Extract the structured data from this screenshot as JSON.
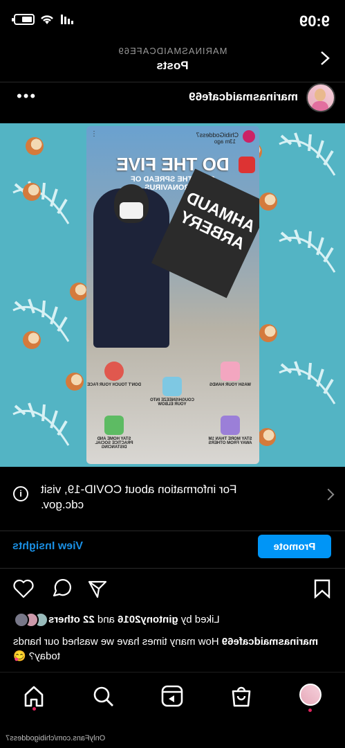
{
  "status_bar": {
    "time": "9:09"
  },
  "header": {
    "account_handle": "MARINASMAIDCAFE69",
    "title": "Posts"
  },
  "post": {
    "username": "marinasmaidcafe69",
    "story": {
      "poster_name": "ChibiGoddess7",
      "poster_time": "13m ago",
      "headline": "DO THE FIVE",
      "subline_1": "STOP THE SPREAD OF",
      "subline_2": "CORONAVIRUS",
      "sign_text_1": "AHMAUD",
      "sign_text_2": "ARBERY",
      "tips": [
        "WASH YOUR HANDS",
        "DON'T TOUCH YOUR FACE",
        "COUGH/SNEEZE INTO YOUR ELBOW",
        "STAY MORE THAN 1M AWAY FROM OTHERS",
        "STAY HOME AND PRACTICE SOCIAL DISTANCING"
      ]
    },
    "info_banner": "For information about COVID-19, visit cdc.gov.",
    "promote_label": "Promote",
    "insights_label": "View Insights",
    "likes": {
      "prefix": "Liked by",
      "user": "gintony2016",
      "joiner": "and",
      "others": "22 others"
    },
    "caption": {
      "user": "marinasmaidcafe69",
      "text": "How many times have we washed our hands today? 😋"
    }
  },
  "watermark": "OnlyFans.com/chibigoddess7",
  "colors": {
    "accent": "#0095f6",
    "link": "#1a8fe3",
    "background": "#000000",
    "media_bg": "#53b4c4"
  }
}
